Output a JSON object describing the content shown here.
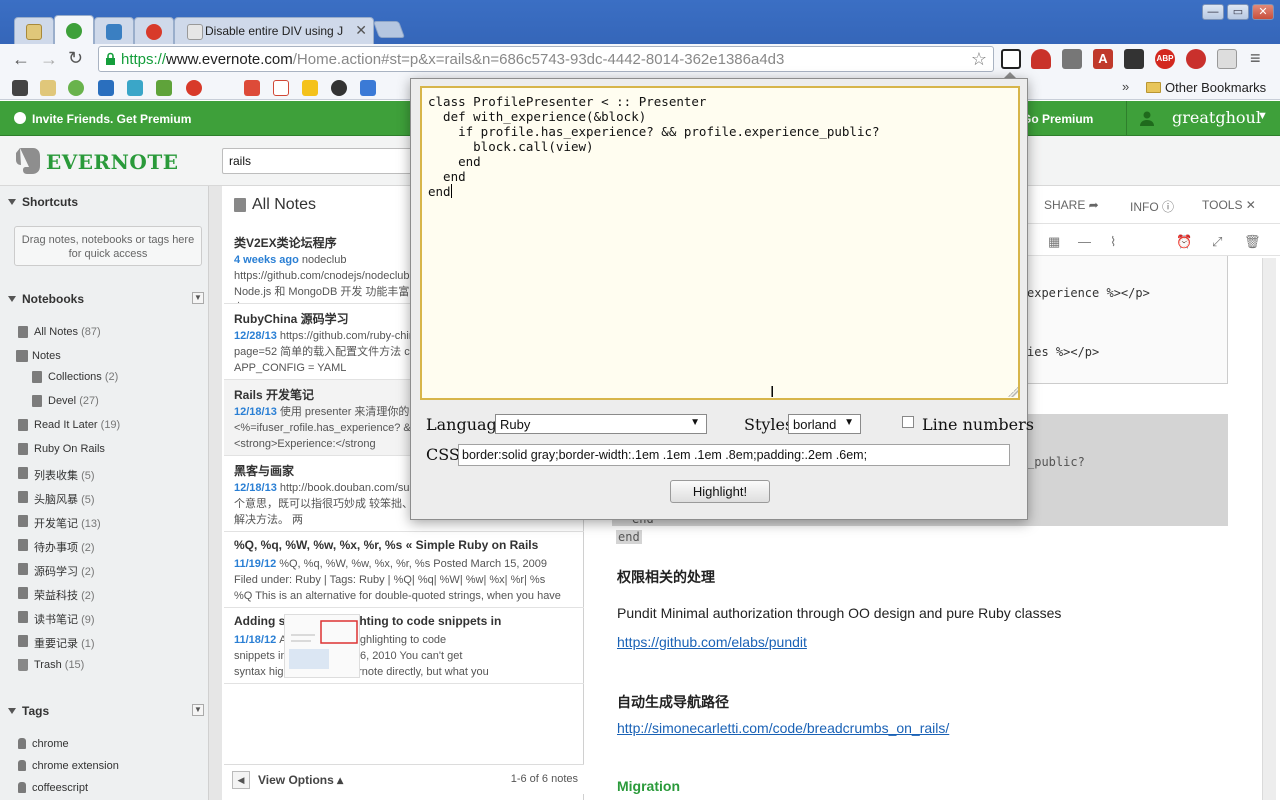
{
  "browser": {
    "tabs": [
      {
        "title": "",
        "icon": "notebook-tab-icon"
      },
      {
        "title": "",
        "icon": "evernote-tab-icon"
      },
      {
        "title": "",
        "icon": "bin-tab-icon"
      },
      {
        "title": "",
        "icon": "weibo-tab-icon"
      },
      {
        "title": "Disable entire DIV using J",
        "icon": "page-tab-icon"
      }
    ],
    "url_scheme": "https://",
    "url_domain": "www.evernote.com",
    "url_path": "/Home.action#st=p&x=rails&n=686c5743-93dc-4442-8014-362e1386a4d3",
    "other_bookmarks": "Other Bookmarks",
    "bookmark_more": "»"
  },
  "promo": {
    "invite": "Invite Friends. Get Premium",
    "go_premium": "Go Premium",
    "username": "greatghoul"
  },
  "header": {
    "logo_text": "EVERNOTE",
    "search_value": "rails"
  },
  "sidebar": {
    "shortcuts_title": "Shortcuts",
    "shortcuts_hint": "Drag notes, notebooks or tags here for quick access",
    "notebooks_title": "Notebooks",
    "notebooks": [
      {
        "name": "All Notes",
        "count": "(87)"
      },
      {
        "name": "Notes",
        "count": ""
      },
      {
        "name": "Collections",
        "count": "(2)"
      },
      {
        "name": "Devel",
        "count": "(27)"
      },
      {
        "name": "Read It Later",
        "count": "(19)"
      },
      {
        "name": "Ruby On Rails",
        "count": ""
      },
      {
        "name": "列表收集",
        "count": "(5)"
      },
      {
        "name": "头脑风暴",
        "count": "(5)"
      },
      {
        "name": "开发笔记",
        "count": "(13)"
      },
      {
        "name": "待办事项",
        "count": "(2)"
      },
      {
        "name": "源码学习",
        "count": "(2)"
      },
      {
        "name": "荣益科技",
        "count": "(2)"
      },
      {
        "name": "读书笔记",
        "count": "(9)"
      },
      {
        "name": "重要记录",
        "count": "(1)"
      },
      {
        "name": "Trash",
        "count": "(15)"
      }
    ],
    "tags_title": "Tags",
    "tags": [
      "chrome",
      "chrome extension",
      "coffeescript"
    ]
  },
  "notelist": {
    "title": "All Notes",
    "notes": [
      {
        "title": "类V2EX类论坛程序",
        "date": "4 weeks ago",
        "body": "nodeclub https://github.com/cnodejs/nodeclub Club 是用 Node.js 和 MongoDB 开发 功能丰富，小巧迅速， 已在Node.js"
      },
      {
        "title": "RubyChina 源码学习",
        "date": "12/28/13",
        "body": "https://github.com/ruby-china/ruby-china page=52 简单的载入配置文件方法 c 配置文件载入APP_CONFIG = YAML"
      },
      {
        "title": "Rails 开发笔记",
        "date": "12/18/13",
        "body": "使用 presenter 来清理你的 <%=ifuser_rofile.has_experience? & %><p><strong>Experience:</strong"
      },
      {
        "title": "黑客与画家",
        "date": "12/18/13",
        "body": "http://book.douban.com/subject 名词有两个意思，既可以指很巧妙成 较笨拙、不那么优雅的解决方法。 两"
      },
      {
        "title": "%Q, %q, %W, %w, %x, %r, %s « Simple Ruby on Rails",
        "date": "11/19/12",
        "body": "%Q, %q, %W, %w, %x, %r, %s Posted March 15, 2009 Filed under: Ruby | Tags: Ruby | %Q| %q| %W| %w| %x| %r| %s %Q This is an alternative for double-quoted strings, when you have"
      },
      {
        "title": "Adding syntax highlighting to code snippets in",
        "date": "11/18/12",
        "body": "Adding syntax highlighting to code snippets in Evernote Jul 16, 2010 You can't get syntax highlighting in Evernote directly, but what you can do"
      }
    ],
    "view_options": "View Options",
    "count": "1-6 of 6 notes"
  },
  "editor": {
    "share": "SHARE",
    "info": "INFO",
    "tools": "TOOLS",
    "code_line1": "experience %></p>",
    "code_line2": "ies %></p>",
    "grey_line": "_public?",
    "grey_end1": "end",
    "grey_end2": "end",
    "section1_title": "权限相关的处理",
    "section1_text": "Pundit Minimal authorization through OO design and pure Ruby classes",
    "section1_link": "https://github.com/elabs/pundit",
    "section2_title": "自动生成导航路径",
    "section2_link": "http://simonecarletti.com/code/breadcrumbs_on_rails/",
    "section3_title": "Migration"
  },
  "popup": {
    "code": "class ProfilePresenter < :: Presenter\n  def with_experience(&block)\n    if profile.has_experience? && profile.experience_public?\n      block.call(view)\n    end\n  end\nend",
    "language_label": "Language",
    "language_value": "Ruby",
    "styles_label": "Styles",
    "styles_value": "borland",
    "line_numbers_label": "Line numbers",
    "css_label": "CSS",
    "css_value": "border:solid gray;border-width:.1em .1em .1em .8em;padding:.2em .6em;",
    "button": "Highlight!"
  },
  "colors": {
    "evernote_green": "#3ea03a",
    "link_blue": "#1a62b6",
    "date_blue": "#2a7fd4",
    "popup_border": "#d7b54a"
  }
}
